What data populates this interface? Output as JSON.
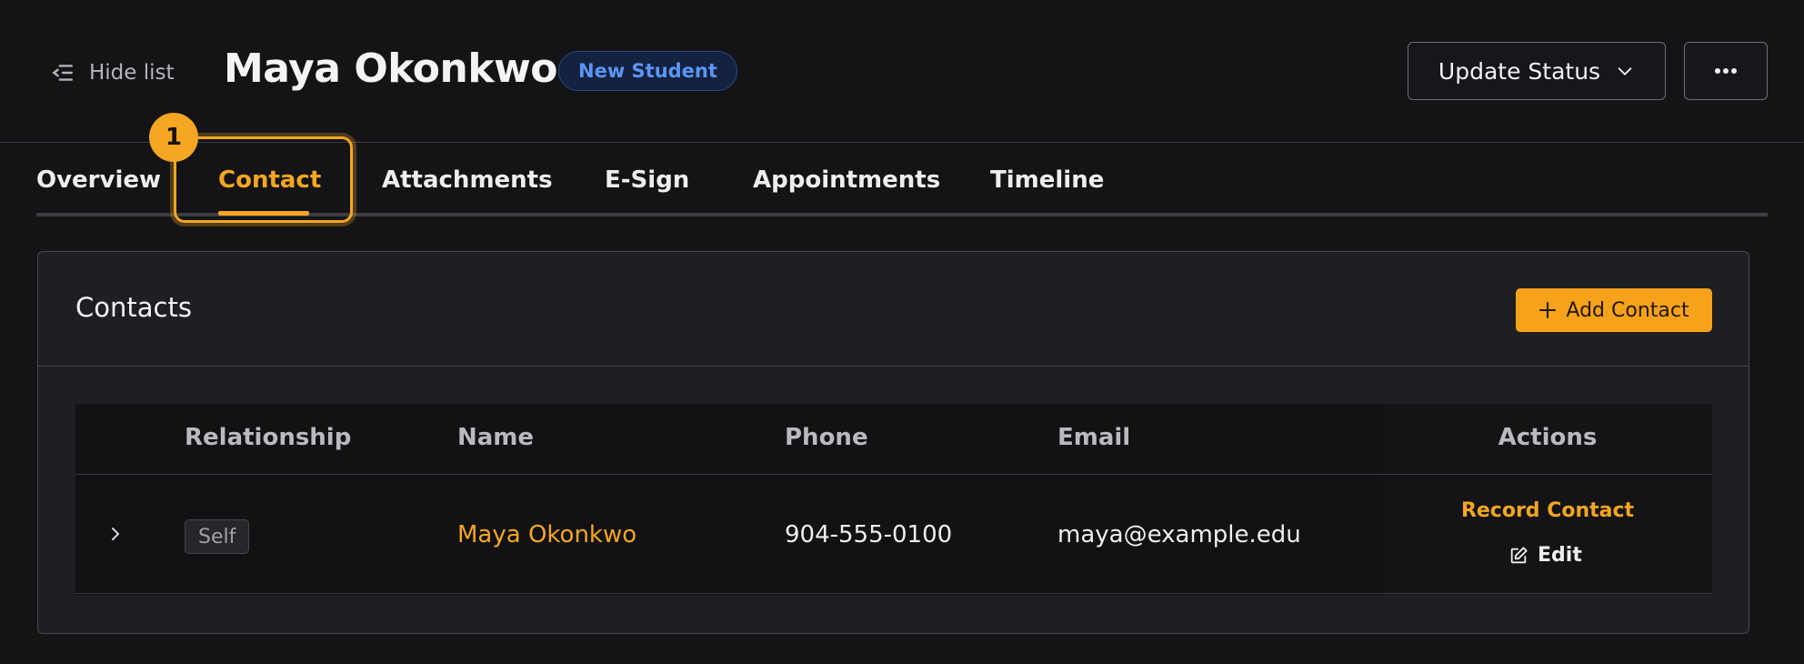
{
  "header": {
    "hide_list_label": "Hide list",
    "title": "Maya Okonkwo",
    "badge": "New Student",
    "update_status_label": "Update Status"
  },
  "tabs": [
    {
      "label": "Overview",
      "active": false
    },
    {
      "label": "Contact",
      "active": true
    },
    {
      "label": "Attachments",
      "active": false
    },
    {
      "label": "E-Sign",
      "active": false
    },
    {
      "label": "Appointments",
      "active": false
    },
    {
      "label": "Timeline",
      "active": false
    }
  ],
  "step_marker": "1",
  "contacts": {
    "title": "Contacts",
    "add_label": "Add Contact",
    "columns": [
      "Relationship",
      "Name",
      "Phone",
      "Email",
      "Actions"
    ],
    "rows": [
      {
        "relationship": "Self",
        "name": "Maya Okonkwo",
        "phone": "904-555-0100",
        "email": "maya@example.edu",
        "action_primary": "Record Contact",
        "action_secondary": "Edit"
      }
    ]
  },
  "colors": {
    "accent": "#f5a623",
    "badge_blue": "#5c95f5",
    "background": "#141416"
  },
  "icons": [
    "list-collapse-icon",
    "chevron-down-icon",
    "ellipsis-icon",
    "plus-icon",
    "chevron-right-icon",
    "edit-icon"
  ]
}
